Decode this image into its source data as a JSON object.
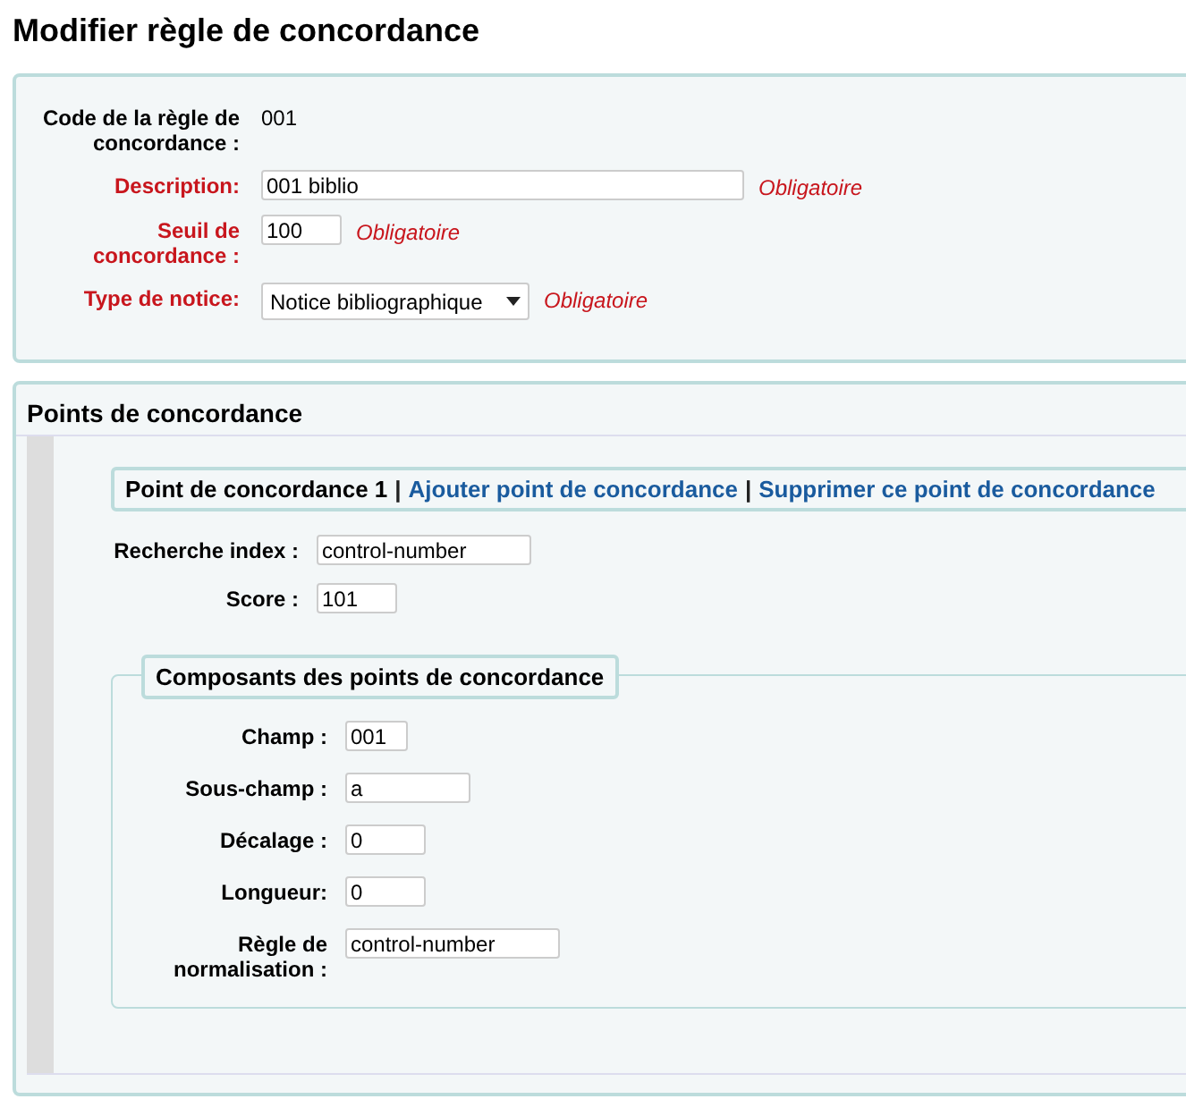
{
  "title": "Modifier règle de concordance",
  "rule_form": {
    "fields": [
      {
        "label": "Code de la règle de concordance :",
        "kind": "text",
        "value": "001",
        "required": false
      },
      {
        "label": "Description:",
        "kind": "input",
        "value": "001 biblio",
        "required": true,
        "note": "Obligatoire"
      },
      {
        "label": "Seuil de concordance :",
        "kind": "input",
        "value": "100",
        "required": true,
        "note": "Obligatoire"
      },
      {
        "label": "Type de notice:",
        "kind": "select",
        "value": "Notice bibliographique",
        "required": true,
        "note": "Obligatoire"
      }
    ]
  },
  "match_points": {
    "heading": "Points de concordance",
    "point": {
      "title": "Point de concordance 1",
      "links": [
        {
          "separator": "|",
          "label": "Ajouter point de concordance"
        },
        {
          "separator": "|",
          "label": "Supprimer ce point de concordance"
        }
      ]
    },
    "fields": [
      {
        "label": "Recherche index :",
        "kind": "input",
        "value": "control-number"
      },
      {
        "label": "Score :",
        "kind": "input",
        "value": "101"
      }
    ],
    "components": {
      "legend": "Composants des points de concordance",
      "fields": [
        {
          "label": "Champ :",
          "kind": "input",
          "value": "001"
        },
        {
          "label": "Sous-champ :",
          "kind": "input",
          "value": "a"
        },
        {
          "label": "Décalage :",
          "kind": "input",
          "value": "0"
        },
        {
          "label": "Longueur:",
          "kind": "input",
          "value": "0"
        },
        {
          "label": "Règle de normalisation :",
          "kind": "input",
          "value": "control-number"
        }
      ]
    }
  }
}
